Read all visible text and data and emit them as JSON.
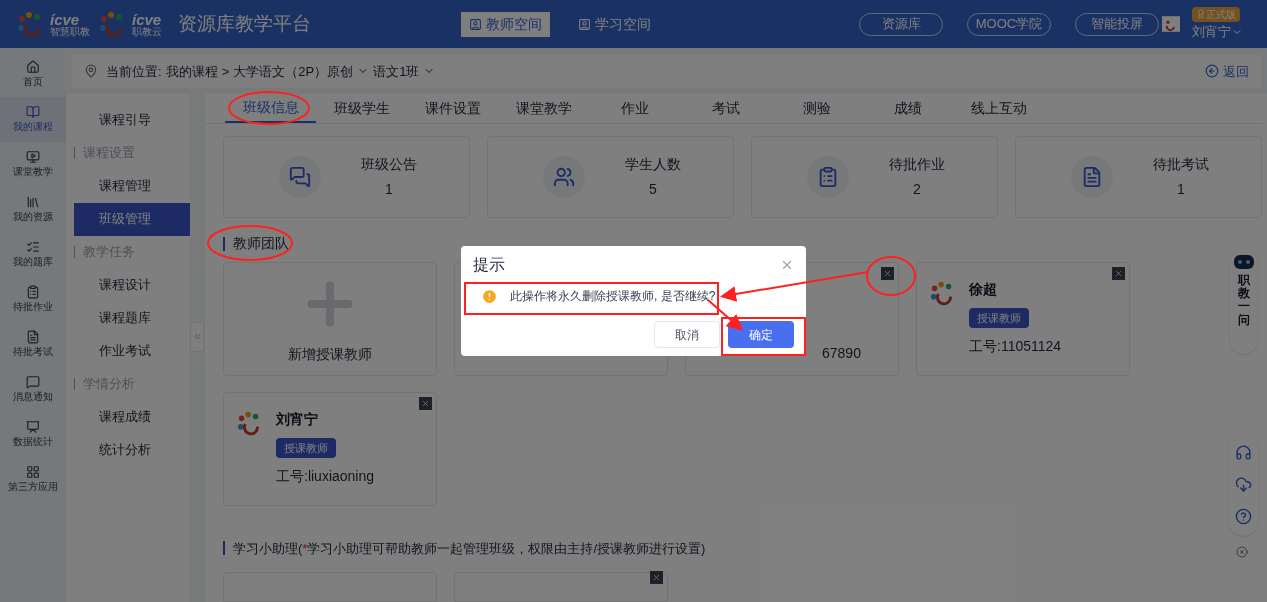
{
  "header": {
    "logos": [
      {
        "name": "ícve",
        "sub": "智慧职教"
      },
      {
        "name": "ícve",
        "sub": "职教云"
      }
    ],
    "title": "资源库教学平台",
    "spaces": [
      {
        "label": "教师空间",
        "selected": true
      },
      {
        "label": "学习空间",
        "selected": false
      }
    ],
    "nav_buttons": [
      "资源库",
      "MOOC学院",
      "智能投屏"
    ],
    "user": {
      "badge": "正式版",
      "name": "刘宵宁"
    }
  },
  "left_nav": [
    {
      "label": "首页",
      "selected": false
    },
    {
      "label": "我的课程",
      "selected": true
    },
    {
      "label": "课堂教学",
      "selected": false
    },
    {
      "label": "我的资源",
      "selected": false
    },
    {
      "label": "我的题库",
      "selected": false
    },
    {
      "label": "待批作业",
      "selected": false
    },
    {
      "label": "待批考试",
      "selected": false
    },
    {
      "label": "消息通知",
      "selected": false
    },
    {
      "label": "数据统计",
      "selected": false
    },
    {
      "label": "第三方应用",
      "selected": false
    }
  ],
  "breadcrumb": {
    "label": "当前位置:",
    "separator": ">",
    "path": [
      "我的课程",
      "大学语文（2P）原创",
      "语文1班"
    ],
    "back": "返回"
  },
  "course_menu": [
    {
      "kind": "link",
      "label": "课程引导",
      "selected": false
    },
    {
      "kind": "group",
      "label": "课程设置"
    },
    {
      "kind": "link",
      "label": "课程管理",
      "selected": false
    },
    {
      "kind": "link",
      "label": "班级管理",
      "selected": true
    },
    {
      "kind": "group",
      "label": "教学任务"
    },
    {
      "kind": "link",
      "label": "课程设计",
      "selected": false
    },
    {
      "kind": "link",
      "label": "课程题库",
      "selected": false
    },
    {
      "kind": "link",
      "label": "作业考试",
      "selected": false
    },
    {
      "kind": "group",
      "label": "学情分析"
    },
    {
      "kind": "link",
      "label": "课程成绩",
      "selected": false
    },
    {
      "kind": "link",
      "label": "统计分析",
      "selected": false
    }
  ],
  "tabs": [
    {
      "label": "班级信息",
      "selected": true
    },
    {
      "label": "班级学生",
      "selected": false
    },
    {
      "label": "课件设置",
      "selected": false
    },
    {
      "label": "课堂教学",
      "selected": false
    },
    {
      "label": "作业",
      "selected": false
    },
    {
      "label": "考试",
      "selected": false
    },
    {
      "label": "测验",
      "selected": false
    },
    {
      "label": "成绩",
      "selected": false
    },
    {
      "label": "线上互动",
      "selected": false
    }
  ],
  "stats": [
    {
      "label": "班级公告",
      "value": "1"
    },
    {
      "label": "学生人数",
      "value": "5"
    },
    {
      "label": "待批作业",
      "value": "2"
    },
    {
      "label": "待批考试",
      "value": "1"
    }
  ],
  "teacher_section": {
    "title": "教师团队",
    "cards": [
      {
        "kind": "add",
        "label": "新增授课教师"
      },
      {
        "kind": "blank"
      },
      {
        "kind": "teacher",
        "id": "67890"
      },
      {
        "kind": "teacher",
        "name": "徐超",
        "role": "授课教师",
        "id": "工号:11051124"
      },
      {
        "kind": "teacher",
        "name": "刘宵宁",
        "role": "授课教师",
        "id": "工号:liuxiaoning"
      }
    ]
  },
  "assistant_section": {
    "title": "学习小助理(",
    "required_mark": "*",
    "note": "学习小助理可帮助教师一起管理班级，权限由主持/授课教师进行设置)",
    "cards": [
      {
        "removable": false
      },
      {
        "removable": true
      }
    ]
  },
  "assistant_robot": {
    "label": "职教一问"
  },
  "dialog": {
    "title": "提示",
    "message": "此操作将永久删除授课教师, 是否继续?",
    "buttons": [
      {
        "label": "取消",
        "kind": "secondary"
      },
      {
        "label": "确定",
        "kind": "primary"
      }
    ]
  }
}
